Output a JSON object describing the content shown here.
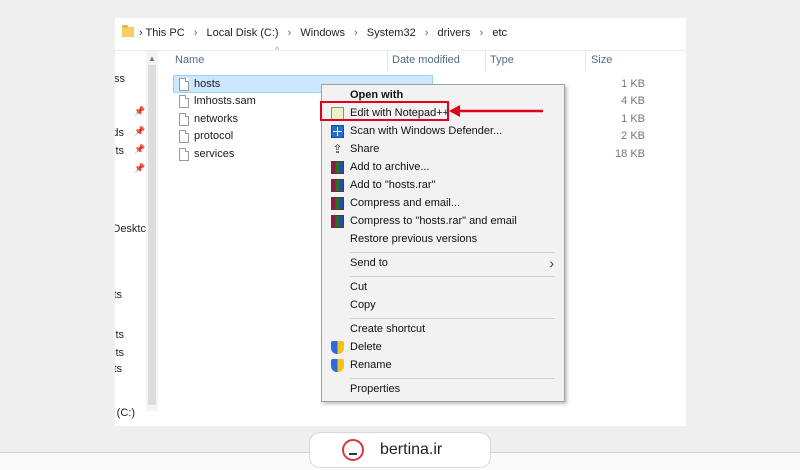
{
  "breadcrumb": [
    "This PC",
    "Local Disk (C:)",
    "Windows",
    "System32",
    "drivers",
    "etc"
  ],
  "nav_pane": {
    "items": [
      "ss",
      "ds",
      "ts",
      "Desktc",
      "ts",
      "ts",
      "ts",
      "ts",
      "(C:)"
    ]
  },
  "columns": [
    "Name",
    "Date modified",
    "Type",
    "Size"
  ],
  "files": [
    {
      "name": "hosts",
      "size": "1 KB"
    },
    {
      "name": "lmhosts.sam",
      "size": "4 KB"
    },
    {
      "name": "networks",
      "size": "1 KB"
    },
    {
      "name": "protocol",
      "size": "2 KB"
    },
    {
      "name": "services",
      "size": "18 KB"
    }
  ],
  "context_menu": {
    "items": [
      {
        "label": "Open with",
        "icon": "none",
        "bold": true
      },
      {
        "label": "Edit with Notepad++",
        "icon": "notepadpp-icon"
      },
      {
        "label": "Scan with Windows Defender...",
        "icon": "defender-icon"
      },
      {
        "label": "Share",
        "icon": "share-icon"
      },
      {
        "label": "Add to archive...",
        "icon": "winrar-icon"
      },
      {
        "label": "Add to \"hosts.rar\"",
        "icon": "winrar-icon"
      },
      {
        "label": "Compress and email...",
        "icon": "winrar-icon"
      },
      {
        "label": "Compress to \"hosts.rar\" and email",
        "icon": "winrar-icon"
      },
      {
        "label": "Restore previous versions",
        "icon": "none"
      },
      {
        "label": "Send to",
        "icon": "none",
        "submenu": true
      },
      {
        "label": "Cut",
        "icon": "none"
      },
      {
        "label": "Copy",
        "icon": "none"
      },
      {
        "label": "Create shortcut",
        "icon": "none"
      },
      {
        "label": "Delete",
        "icon": "uac-shield-icon"
      },
      {
        "label": "Rename",
        "icon": "uac-shield-icon"
      },
      {
        "label": "Properties",
        "icon": "none"
      }
    ]
  },
  "annotation": {
    "highlight_color": "#e0001b"
  },
  "watermark": {
    "brand": "bertina.ir",
    "logo_icon": "bertina-logo-icon"
  },
  "colors": {
    "selection": "#cce8ff",
    "header_text": "#4f6d8a",
    "menu_bg": "#f2f2f2"
  }
}
